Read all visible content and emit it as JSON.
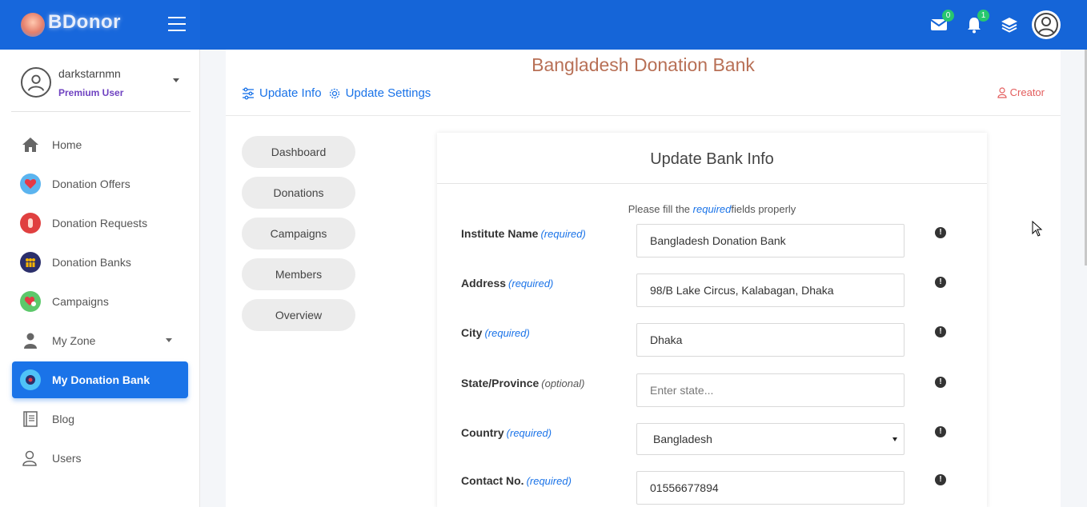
{
  "brand": {
    "name": "BDonor"
  },
  "header": {
    "mail_count": "0",
    "notification_count": "1"
  },
  "user": {
    "name": "darkstarnmn",
    "role": "Premium User"
  },
  "sidebar": {
    "items": [
      {
        "label": "Home",
        "icon": "home-icon"
      },
      {
        "label": "Donation Offers",
        "icon": "heart-hand-icon"
      },
      {
        "label": "Donation Requests",
        "icon": "hand-icon"
      },
      {
        "label": "Donation Banks",
        "icon": "people-icon"
      },
      {
        "label": "Campaigns",
        "icon": "campaign-icon"
      },
      {
        "label": "My Zone",
        "icon": "person-icon"
      },
      {
        "label": "My Donation Bank",
        "icon": "bank-icon"
      },
      {
        "label": "Blog",
        "icon": "notebook-icon"
      },
      {
        "label": "Users",
        "icon": "users-icon"
      }
    ],
    "active": "My Donation Bank"
  },
  "page": {
    "title": "Bangladesh Donation Bank",
    "tabs": [
      {
        "label": "Update Info"
      },
      {
        "label": "Update Settings"
      }
    ],
    "creator_label": "Creator"
  },
  "pills": [
    "Dashboard",
    "Donations",
    "Campaigns",
    "Members",
    "Overview"
  ],
  "form": {
    "title": "Update Bank Info",
    "note_prefix": "Please fill the",
    "note_required": "required",
    "note_suffix": "fields properly",
    "fields": [
      {
        "label": "Institute Name",
        "tag": "(required)",
        "value": "Bangladesh Donation Bank",
        "placeholder": ""
      },
      {
        "label": "Address",
        "tag": "(required)",
        "value": "98/B Lake Circus, Kalabagan, Dhaka",
        "placeholder": ""
      },
      {
        "label": "City",
        "tag": "(required)",
        "value": "Dhaka",
        "placeholder": ""
      },
      {
        "label": "State/Province",
        "tag": "(optional)",
        "value": "",
        "placeholder": "Enter state..."
      },
      {
        "label": "Country",
        "tag": "(required)",
        "value": "Bangladesh",
        "placeholder": ""
      },
      {
        "label": "Contact No.",
        "tag": "(required)",
        "value": "01556677894",
        "placeholder": ""
      }
    ]
  },
  "colors": {
    "topbar": "#1565d8",
    "active": "#1a73e8",
    "title": "#b87056",
    "creator": "#e35d5d",
    "premium": "#6f42c1"
  }
}
